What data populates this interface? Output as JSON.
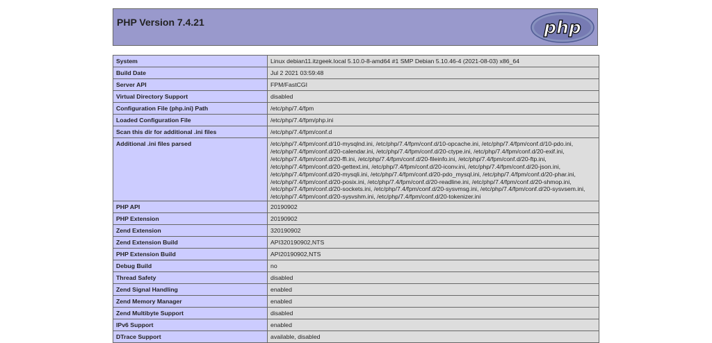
{
  "header": {
    "title": "PHP Version 7.4.21",
    "logo_text": "php"
  },
  "colors": {
    "header_bg": "#9999cc",
    "key_bg": "#ccccff",
    "value_bg": "#dddddd",
    "border": "#666666"
  },
  "rows": [
    {
      "key": "System",
      "value": "Linux debian11.itzgeek.local 5.10.0-8-amd64 #1 SMP Debian 5.10.46-4 (2021-08-03) x86_64"
    },
    {
      "key": "Build Date",
      "value": "Jul 2 2021 03:59:48"
    },
    {
      "key": "Server API",
      "value": "FPM/FastCGI"
    },
    {
      "key": "Virtual Directory Support",
      "value": "disabled"
    },
    {
      "key": "Configuration File (php.ini) Path",
      "value": "/etc/php/7.4/fpm"
    },
    {
      "key": "Loaded Configuration File",
      "value": "/etc/php/7.4/fpm/php.ini"
    },
    {
      "key": "Scan this dir for additional .ini files",
      "value": "/etc/php/7.4/fpm/conf.d"
    },
    {
      "key": "Additional .ini files parsed",
      "value": "/etc/php/7.4/fpm/conf.d/10-mysqlnd.ini, /etc/php/7.4/fpm/conf.d/10-opcache.ini, /etc/php/7.4/fpm/conf.d/10-pdo.ini, /etc/php/7.4/fpm/conf.d/20-calendar.ini, /etc/php/7.4/fpm/conf.d/20-ctype.ini, /etc/php/7.4/fpm/conf.d/20-exif.ini, /etc/php/7.4/fpm/conf.d/20-ffi.ini, /etc/php/7.4/fpm/conf.d/20-fileinfo.ini, /etc/php/7.4/fpm/conf.d/20-ftp.ini, /etc/php/7.4/fpm/conf.d/20-gettext.ini, /etc/php/7.4/fpm/conf.d/20-iconv.ini, /etc/php/7.4/fpm/conf.d/20-json.ini, /etc/php/7.4/fpm/conf.d/20-mysqli.ini, /etc/php/7.4/fpm/conf.d/20-pdo_mysql.ini, /etc/php/7.4/fpm/conf.d/20-phar.ini, /etc/php/7.4/fpm/conf.d/20-posix.ini, /etc/php/7.4/fpm/conf.d/20-readline.ini, /etc/php/7.4/fpm/conf.d/20-shmop.ini, /etc/php/7.4/fpm/conf.d/20-sockets.ini, /etc/php/7.4/fpm/conf.d/20-sysvmsg.ini, /etc/php/7.4/fpm/conf.d/20-sysvsem.ini, /etc/php/7.4/fpm/conf.d/20-sysvshm.ini, /etc/php/7.4/fpm/conf.d/20-tokenizer.ini"
    },
    {
      "key": "PHP API",
      "value": "20190902"
    },
    {
      "key": "PHP Extension",
      "value": "20190902"
    },
    {
      "key": "Zend Extension",
      "value": "320190902"
    },
    {
      "key": "Zend Extension Build",
      "value": "API320190902,NTS"
    },
    {
      "key": "PHP Extension Build",
      "value": "API20190902,NTS"
    },
    {
      "key": "Debug Build",
      "value": "no"
    },
    {
      "key": "Thread Safety",
      "value": "disabled"
    },
    {
      "key": "Zend Signal Handling",
      "value": "enabled"
    },
    {
      "key": "Zend Memory Manager",
      "value": "enabled"
    },
    {
      "key": "Zend Multibyte Support",
      "value": "disabled"
    },
    {
      "key": "IPv6 Support",
      "value": "enabled"
    },
    {
      "key": "DTrace Support",
      "value": "available, disabled"
    }
  ]
}
